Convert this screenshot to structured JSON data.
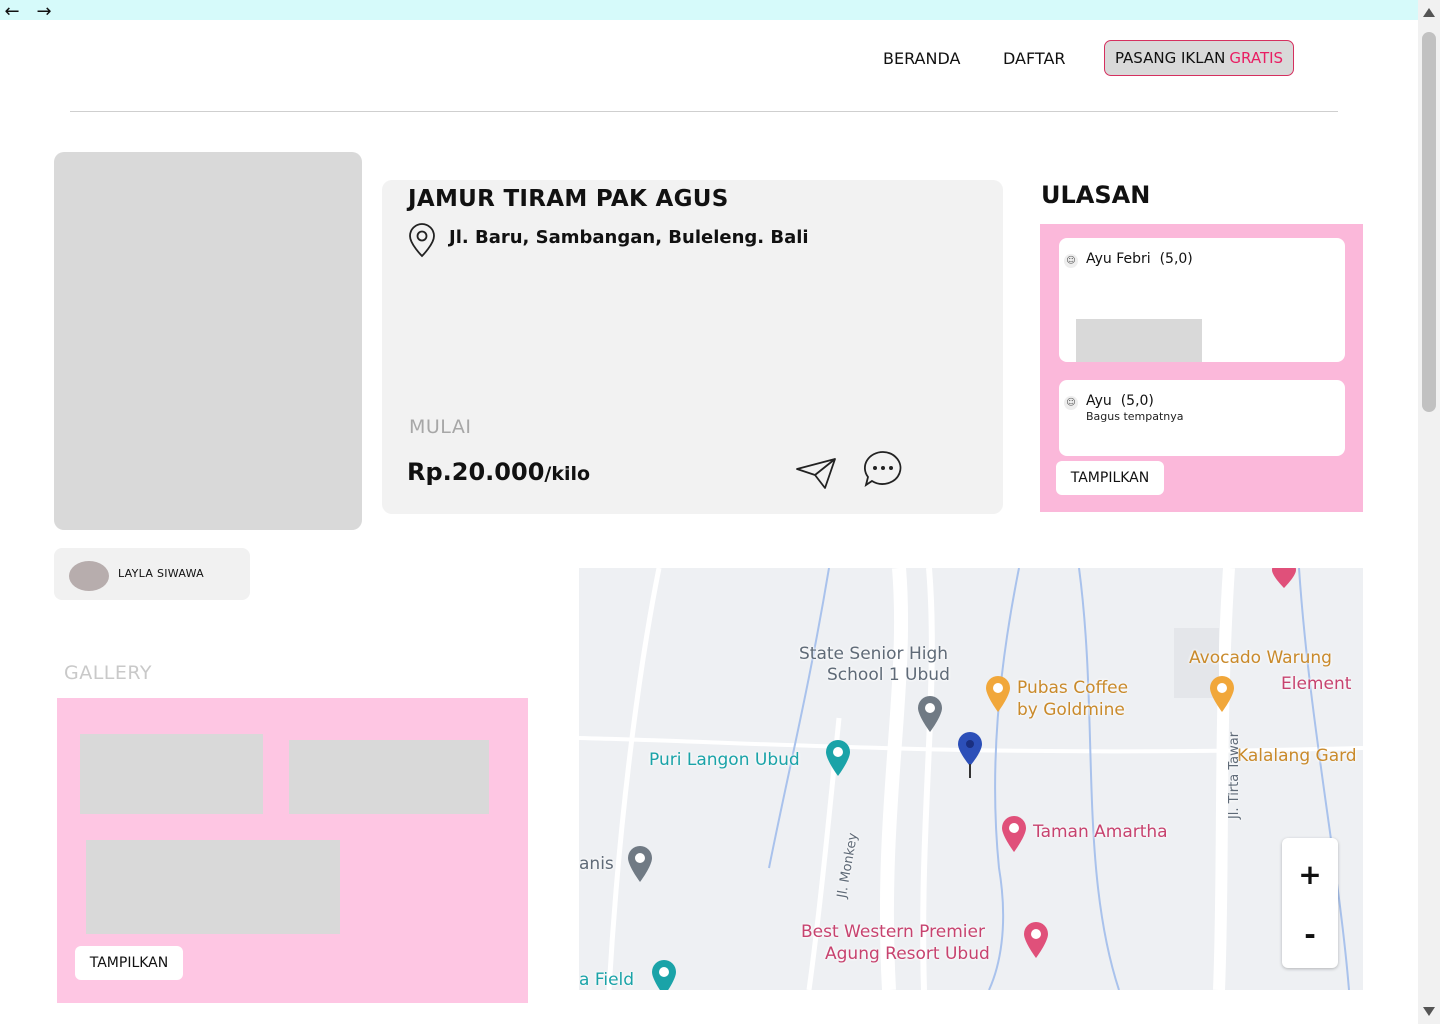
{
  "header": {
    "nav": {
      "back": "←",
      "forward": "→"
    },
    "menu": [
      {
        "label": "BERANDA"
      },
      {
        "label": "DAFTAR"
      }
    ],
    "cta": {
      "label": "PASANG IKLAN",
      "accent": "GRATIS"
    }
  },
  "product": {
    "title": "JAMUR TIRAM PAK AGUS",
    "address": "Jl. Baru, Sambangan, Buleleng. Bali",
    "mulai": "MULAI",
    "price": "Rp.20.000",
    "unit": "/kilo"
  },
  "reviews": {
    "title": "ULASAN",
    "items": [
      {
        "name": "Ayu Febri",
        "rating": "(5,0)",
        "text": ""
      },
      {
        "name": "Ayu",
        "rating": "(5,0)",
        "text": "Bagus tempatnya"
      }
    ],
    "button": "TAMPILKAN"
  },
  "seller": {
    "name": "LAYLA SIWAWA"
  },
  "gallery": {
    "title": "GALLERY",
    "button": "TAMPILKAN"
  },
  "map": {
    "labels": [
      {
        "text": "State Senior High",
        "style": "grey"
      },
      {
        "text": "School 1 Ubud",
        "style": "grey"
      },
      {
        "text": "Pubas Coffee",
        "style": "orange"
      },
      {
        "text": "by Goldmine",
        "style": "orange"
      },
      {
        "text": "Avocado Warung",
        "style": "orange"
      },
      {
        "text": "Element",
        "style": "pink"
      },
      {
        "text": "Kalalang Gard",
        "style": "orange"
      },
      {
        "text": "Puri Langon Ubud",
        "style": "teal"
      },
      {
        "text": "Taman Amartha",
        "style": "pink"
      },
      {
        "text": "Best Western Premier",
        "style": "pink"
      },
      {
        "text": "Agung Resort Ubud",
        "style": "pink"
      },
      {
        "text": "Jl. Monkey",
        "style": "grey"
      },
      {
        "text": "Jl. Tirta Tawar",
        "style": "grey"
      },
      {
        "text": "anis",
        "style": "grey"
      },
      {
        "text": "a Field",
        "style": "teal"
      }
    ],
    "zoom_in": "+",
    "zoom_out": "-"
  },
  "colors": {
    "accent": "#e91e63",
    "review_panel": "#fbb8da",
    "gallery_panel": "#fec6e3",
    "topbar": "#d6fafa"
  }
}
